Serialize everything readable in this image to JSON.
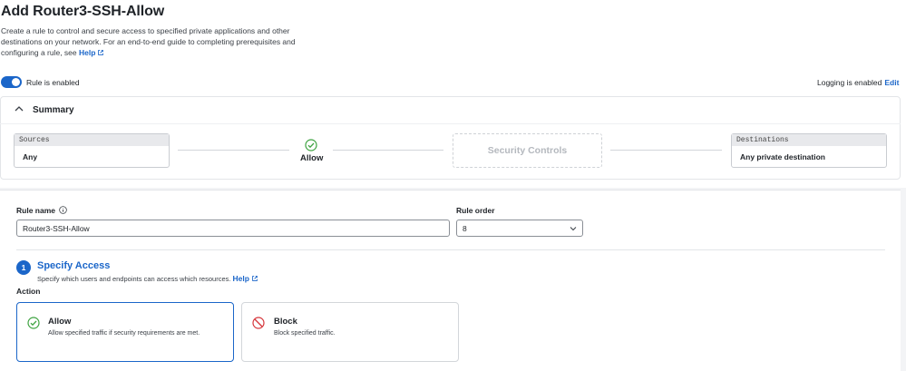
{
  "page": {
    "title": "Add Router3-SSH-Allow",
    "description": "Create a rule to control and secure access to specified private applications and other destinations on your network. For an end-to-end guide to completing prerequisites and configuring a rule, see",
    "help_link": "Help"
  },
  "rule_toggle": {
    "label": "Rule is enabled",
    "enabled": true
  },
  "logging": {
    "status": "Logging is enabled",
    "edit_label": "Edit"
  },
  "summary": {
    "heading": "Summary",
    "sources": {
      "caption": "Sources",
      "value": "Any"
    },
    "action": {
      "label": "Allow"
    },
    "security_controls": {
      "label": "Security Controls"
    },
    "destinations": {
      "caption": "Destinations",
      "value": "Any private destination"
    }
  },
  "form": {
    "rule_name": {
      "label": "Rule name",
      "value": "Router3-SSH-Allow"
    },
    "rule_order": {
      "label": "Rule order",
      "value": "8"
    }
  },
  "step1": {
    "number": "1",
    "title": "Specify Access",
    "subtitle": "Specify which users and endpoints can access which resources.",
    "help_link": "Help",
    "action_label": "Action",
    "options": [
      {
        "title": "Allow",
        "description": "Allow specified traffic if security requirements are met.",
        "selected": true
      },
      {
        "title": "Block",
        "description": "Block specified traffic.",
        "selected": false
      }
    ]
  },
  "colors": {
    "accent": "#1b66c9",
    "success": "#3ea341",
    "danger": "#d6363b"
  }
}
